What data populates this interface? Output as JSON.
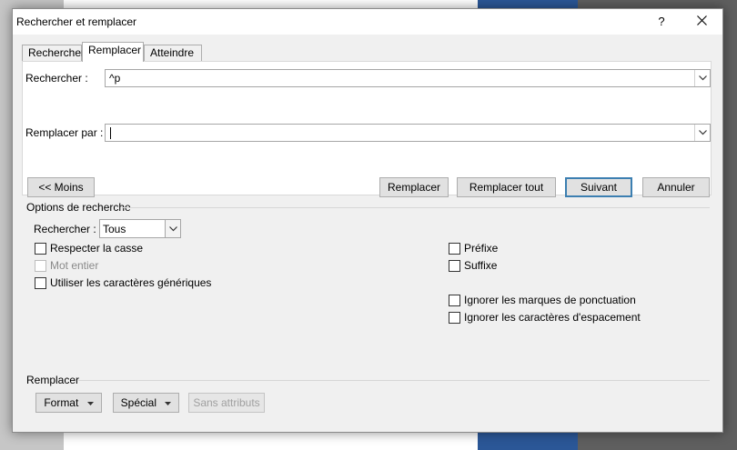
{
  "window": {
    "title": "Rechercher et remplacer",
    "help_label": "?"
  },
  "tabs": [
    {
      "label": "Rechercher",
      "active": false
    },
    {
      "label": "Remplacer",
      "active": true
    },
    {
      "label": "Atteindre",
      "active": false
    }
  ],
  "find": {
    "label": "Rechercher :",
    "value": "^p"
  },
  "replace": {
    "label": "Remplacer par :",
    "value": ""
  },
  "buttons": {
    "less": "<< Moins",
    "replace": "Remplacer",
    "replace_all": "Remplacer tout",
    "next": "Suivant",
    "cancel": "Annuler"
  },
  "options": {
    "title": "Options de recherche",
    "search_label": "Rechercher :",
    "search_value": "Tous",
    "left_checkboxes": [
      {
        "label": "Respecter la casse",
        "checked": false,
        "enabled": true
      },
      {
        "label": "Mot entier",
        "checked": false,
        "enabled": false
      },
      {
        "label": "Utiliser les caractères génériques",
        "checked": false,
        "enabled": true
      }
    ],
    "right_checkboxes": [
      {
        "label": "Préfixe",
        "checked": false,
        "enabled": true
      },
      {
        "label": "Suffixe",
        "checked": false,
        "enabled": true
      },
      {
        "label": "Ignorer les marques de ponctuation",
        "checked": false,
        "enabled": true
      },
      {
        "label": "Ignorer les caractères d'espacement",
        "checked": false,
        "enabled": true
      }
    ]
  },
  "replace_section": {
    "title": "Remplacer",
    "format": "Format",
    "special": "Spécial",
    "no_attributes": "Sans attributs"
  },
  "colors": {
    "default_button_border": "#3c7fb1",
    "dialog_background": "#f0f0f0"
  }
}
